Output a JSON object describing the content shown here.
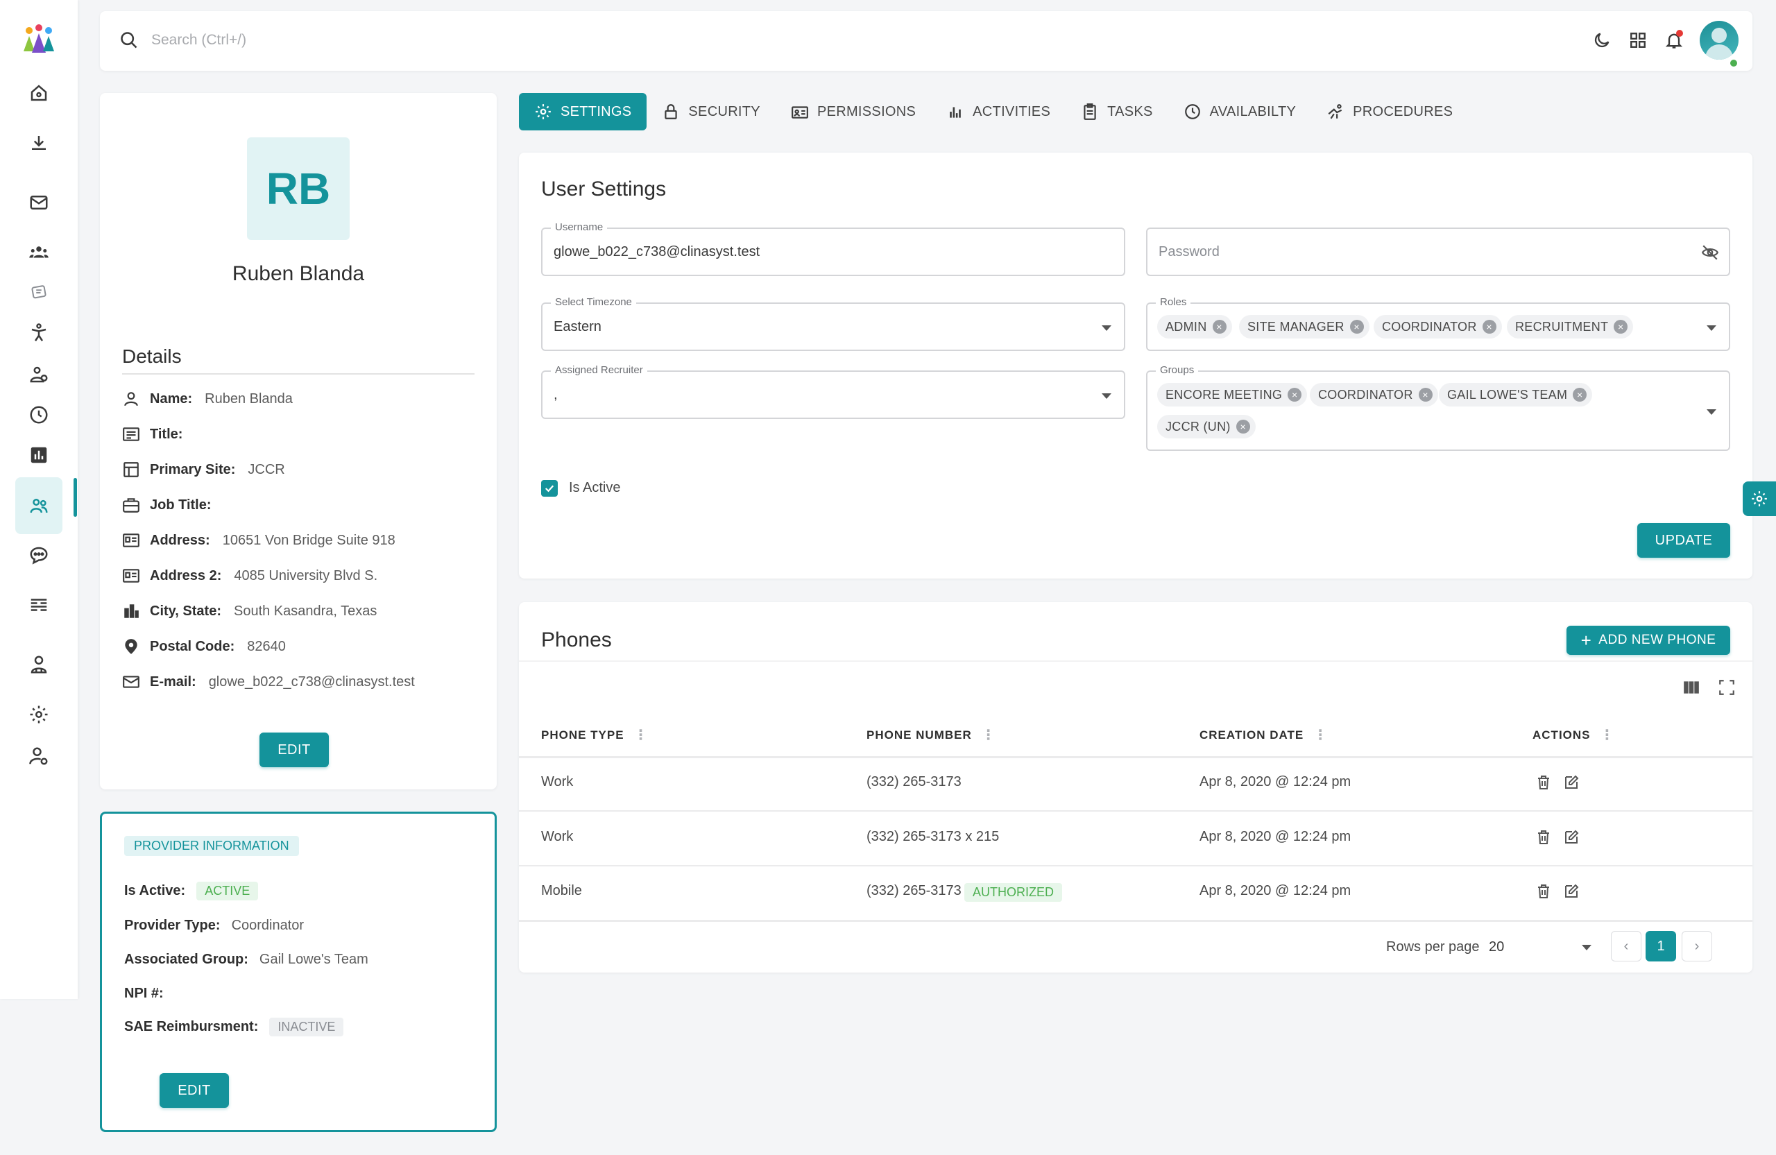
{
  "topbar": {
    "search_placeholder": "Search (Ctrl+/)",
    "icons": [
      "moon-icon",
      "grid-icon",
      "bell-icon",
      "avatar"
    ]
  },
  "sidebar": {
    "items": [
      "home-icon",
      "download-icon",
      "mail-icon",
      "group-icon",
      "payments-icon",
      "accessibility-icon",
      "manage-users-icon",
      "clock-icon",
      "chart-icon",
      "people-icon",
      "chat-icon",
      "list-icon",
      "doctor-icon",
      "gear-icon",
      "user-settings-icon"
    ],
    "active_index": 9
  },
  "profile": {
    "initials": "RB",
    "name": "Ruben Blanda",
    "details_title": "Details",
    "details": [
      {
        "label": "Name:",
        "value": "Ruben Blanda",
        "icon": "person-icon"
      },
      {
        "label": "Title:",
        "value": "",
        "icon": "title-icon"
      },
      {
        "label": "Primary Site:",
        "value": "JCCR",
        "icon": "site-icon"
      },
      {
        "label": "Job Title:",
        "value": "",
        "icon": "briefcase-icon"
      },
      {
        "label": "Address:",
        "value": "10651 Von Bridge Suite 918",
        "icon": "address-card-icon"
      },
      {
        "label": "Address 2:",
        "value": "4085 University Blvd S.",
        "icon": "address-card-icon"
      },
      {
        "label": "City, State:",
        "value": "South Kasandra, Texas",
        "icon": "city-icon"
      },
      {
        "label": "Postal Code:",
        "value": "82640",
        "icon": "location-pin-icon"
      },
      {
        "label": "E-mail:",
        "value": "glowe_b022_c738@clinasyst.test",
        "icon": "mail-icon"
      }
    ],
    "edit_label": "EDIT"
  },
  "provider": {
    "title": "PROVIDER INFORMATION",
    "is_active_label": "Is Active:",
    "is_active_value": "ACTIVE",
    "provider_type_label": "Provider Type:",
    "provider_type_value": "Coordinator",
    "assoc_group_label": "Associated Group:",
    "assoc_group_value": "Gail Lowe's Team",
    "npi_label": "NPI #:",
    "npi_value": "",
    "sae_label": "SAE Reimbursment:",
    "sae_value": "INACTIVE",
    "edit_label": "EDIT"
  },
  "tabs": [
    {
      "label": "SETTINGS",
      "icon": "gear-icon",
      "active": true
    },
    {
      "label": "SECURITY",
      "icon": "lock-icon",
      "active": false
    },
    {
      "label": "PERMISSIONS",
      "icon": "permissions-icon",
      "active": false
    },
    {
      "label": "ACTIVITIES",
      "icon": "bar-chart-icon",
      "active": false
    },
    {
      "label": "TASKS",
      "icon": "clipboard-icon",
      "active": false
    },
    {
      "label": "AVAILABILTY",
      "icon": "clock-icon",
      "active": false
    },
    {
      "label": "PROCEDURES",
      "icon": "procedures-icon",
      "active": false
    }
  ],
  "user_settings": {
    "title": "User Settings",
    "username_label": "Username",
    "username_value": "glowe_b022_c738@clinasyst.test",
    "password_placeholder": "Password",
    "timezone_label": "Select Timezone",
    "timezone_value": "Eastern",
    "roles_label": "Roles",
    "roles": [
      "ADMIN",
      "SITE MANAGER",
      "COORDINATOR",
      "RECRUITMENT"
    ],
    "recruiter_label": "Assigned Recruiter",
    "recruiter_value": ",",
    "groups_label": "Groups",
    "groups": [
      "ENCORE MEETING",
      "COORDINATOR",
      "GAIL LOWE'S TEAM",
      "JCCR (UN)"
    ],
    "is_active_label": "Is Active",
    "is_active_checked": true,
    "update_label": "UPDATE"
  },
  "phones": {
    "title": "Phones",
    "add_label": "ADD NEW PHONE",
    "columns": [
      "PHONE TYPE",
      "PHONE NUMBER",
      "CREATION DATE",
      "ACTIONS"
    ],
    "rows": [
      {
        "type": "Work",
        "number": "(332) 265-3173",
        "badge": "",
        "date": "Apr 8, 2020 @ 12:24 pm"
      },
      {
        "type": "Work",
        "number": "(332) 265-3173 x 215",
        "badge": "",
        "date": "Apr 8, 2020 @ 12:24 pm"
      },
      {
        "type": "Mobile",
        "number": "(332) 265-3173",
        "badge": "AUTHORIZED",
        "date": "Apr 8, 2020 @ 12:24 pm"
      }
    ],
    "rows_per_page_label": "Rows per page",
    "rows_per_page_value": "20",
    "current_page": "1"
  },
  "colors": {
    "accent": "#14939b",
    "accent_light": "#e1f3f4",
    "success": "#4caf50",
    "danger": "#e53935"
  }
}
